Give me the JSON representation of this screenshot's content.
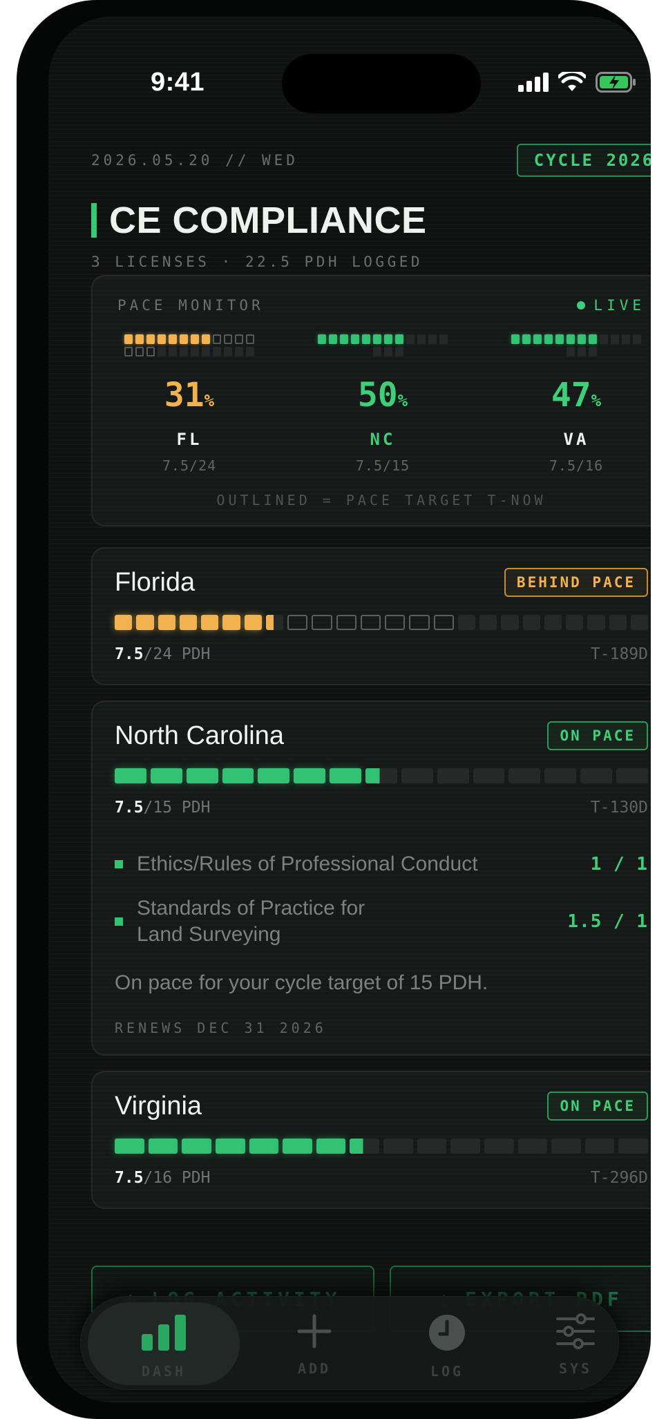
{
  "status_bar": {
    "time": "9:41"
  },
  "header": {
    "date": "2026.05.20 // WED",
    "cycle_badge": "CYCLE 2026",
    "title": "CE COMPLIANCE",
    "subtitle": "3 LICENSES · 22.5 PDH LOGGED"
  },
  "pace_monitor": {
    "label": "PACE MONITOR",
    "live": "LIVE",
    "footnote": "OUTLINED = PACE TARGET T-NOW",
    "states": [
      {
        "code": "FL",
        "percent": "31",
        "unit": "%",
        "ratio": "7.5/24",
        "color": "#f2b24f"
      },
      {
        "code": "NC",
        "percent": "50",
        "unit": "%",
        "ratio": "7.5/15",
        "color": "#3ecf7a"
      },
      {
        "code": "VA",
        "percent": "47",
        "unit": "%",
        "ratio": "7.5/16",
        "color": "#3ecf7a"
      }
    ]
  },
  "licenses": [
    {
      "name": "Florida",
      "status": "BEHIND PACE",
      "earned": "7.5",
      "required": "/24 PDH",
      "days": "T-189D",
      "progress": 0.3125
    },
    {
      "name": "North Carolina",
      "status": "ON PACE",
      "earned": "7.5",
      "required": "/15 PDH",
      "days": "T-130D",
      "progress": 0.5,
      "requirements": [
        {
          "name": "Ethics/Rules of Professional Conduct",
          "value": "1 / 1"
        },
        {
          "name_line1": "Standards of Practice for",
          "name_line2": "Land Surveying",
          "value": "1.5 / 1"
        }
      ],
      "note": "On pace for your cycle target of 15 PDH.",
      "renews": "RENEWS DEC 31 2026"
    },
    {
      "name": "Virginia",
      "status": "ON PACE",
      "earned": "7.5",
      "required": "/16 PDH",
      "days": "T-296D",
      "progress": 0.46875
    }
  ],
  "actions": {
    "log": "LOG ACTIVITY",
    "export": "EXPORT PDF"
  },
  "tabs": [
    {
      "label": "DASH",
      "icon": "bar-chart-icon"
    },
    {
      "label": "ADD",
      "icon": "plus-icon"
    },
    {
      "label": "LOG",
      "icon": "clock-icon"
    },
    {
      "label": "SYS",
      "icon": "sliders-icon"
    }
  ]
}
